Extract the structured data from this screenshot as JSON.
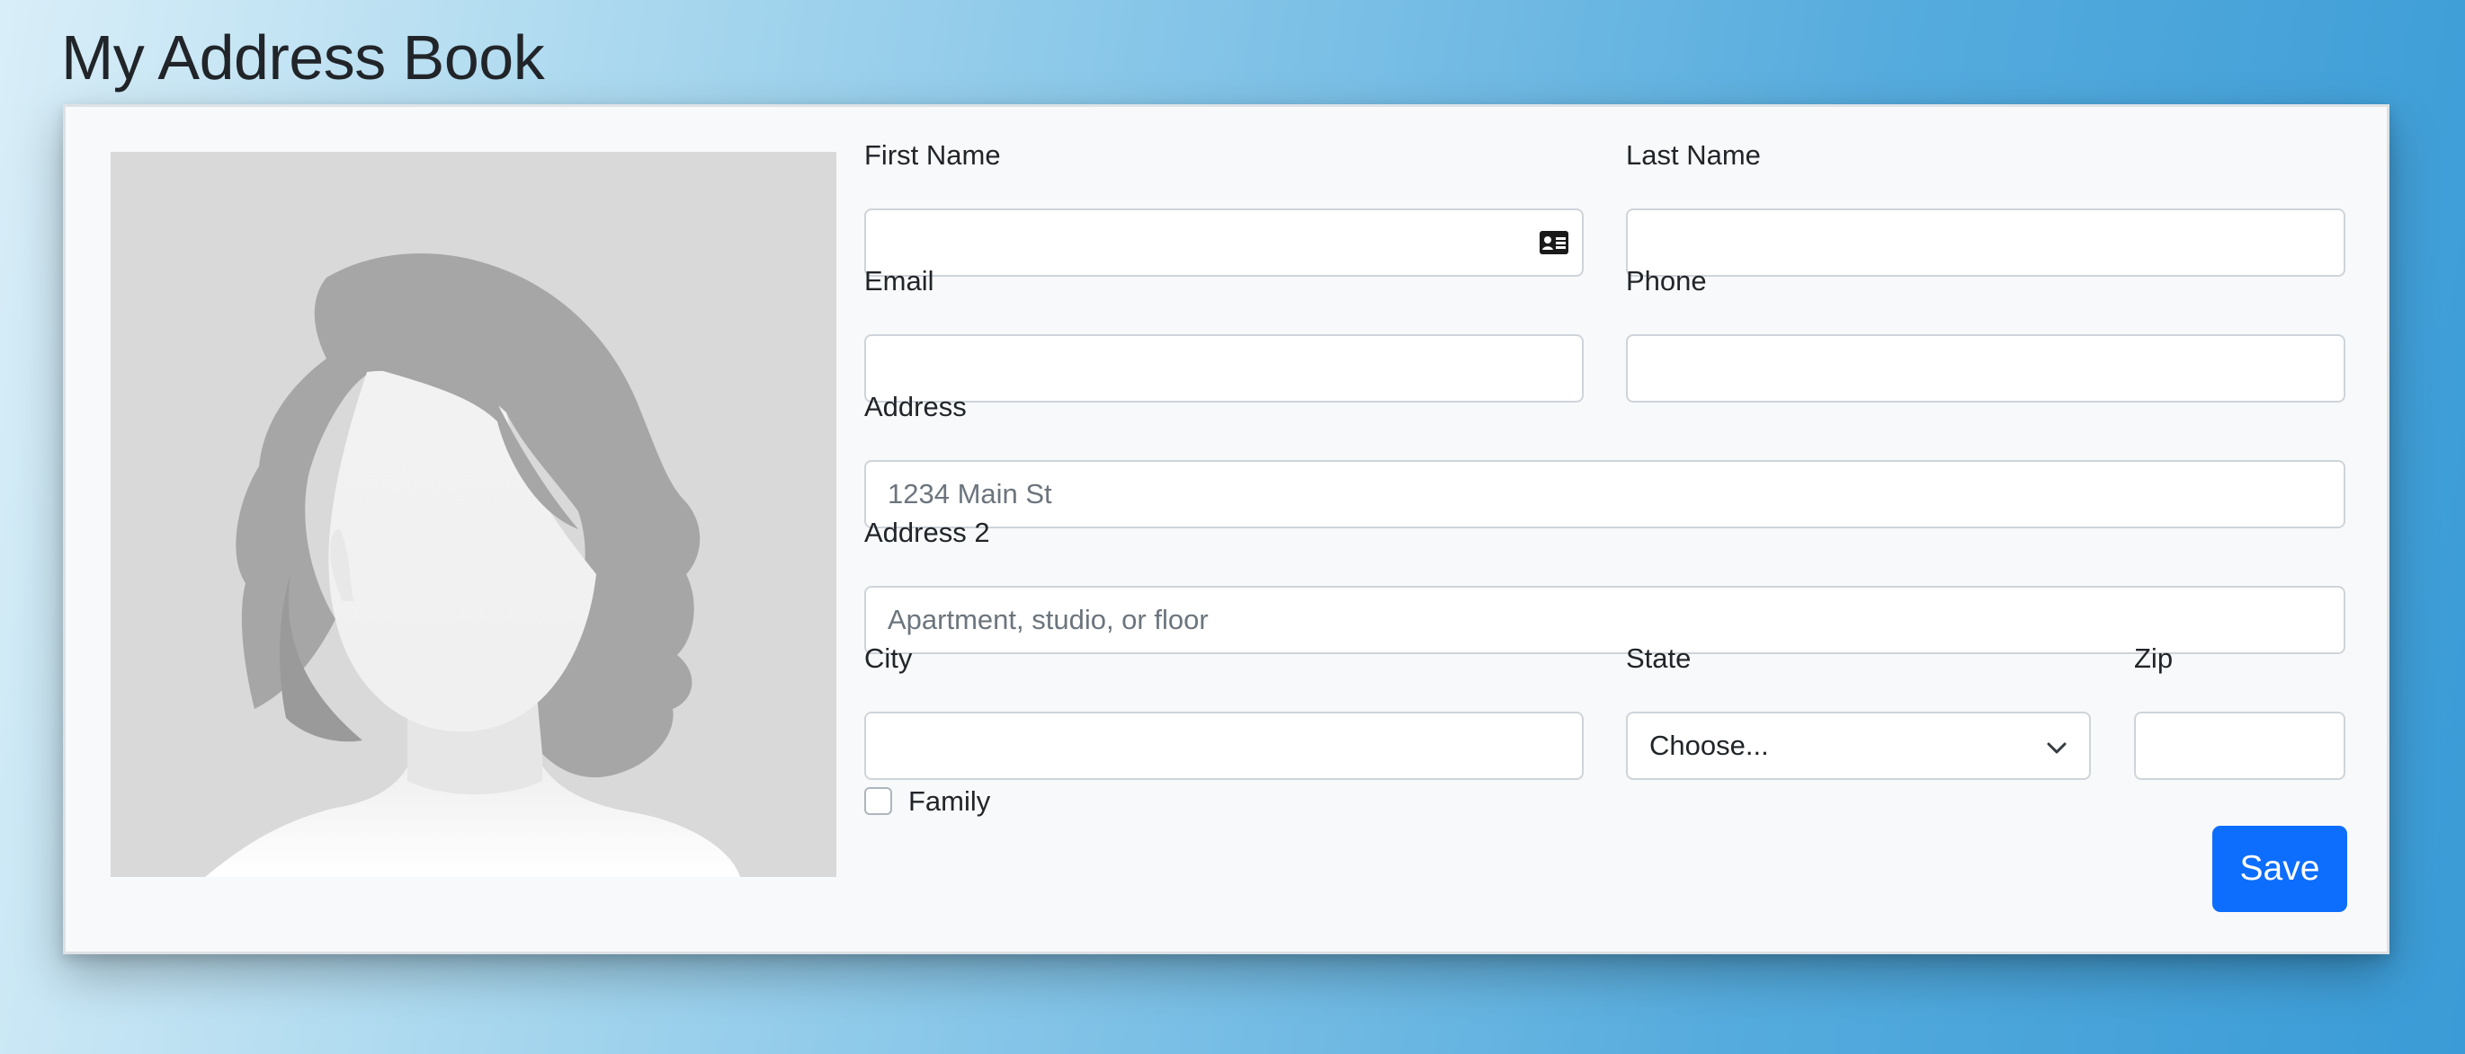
{
  "page": {
    "title": "My Address Book"
  },
  "form": {
    "first_name": {
      "label": "First Name",
      "value": "",
      "icon": "contact-card-icon"
    },
    "last_name": {
      "label": "Last Name",
      "value": ""
    },
    "email": {
      "label": "Email",
      "value": ""
    },
    "phone": {
      "label": "Phone",
      "value": ""
    },
    "address": {
      "label": "Address",
      "value": "",
      "placeholder": "1234 Main St"
    },
    "address2": {
      "label": "Address 2",
      "value": "",
      "placeholder": "Apartment, studio, or floor"
    },
    "city": {
      "label": "City",
      "value": ""
    },
    "state": {
      "label": "State",
      "selected": "Choose..."
    },
    "zip": {
      "label": "Zip",
      "value": ""
    },
    "family": {
      "label": "Family",
      "checked": false
    },
    "save_label": "Save"
  },
  "colors": {
    "primary": "#0d6efd",
    "card_background": "#f8f9fa",
    "avatar_background": "#d9d9d9",
    "avatar_hair": "#a6a6a6"
  }
}
